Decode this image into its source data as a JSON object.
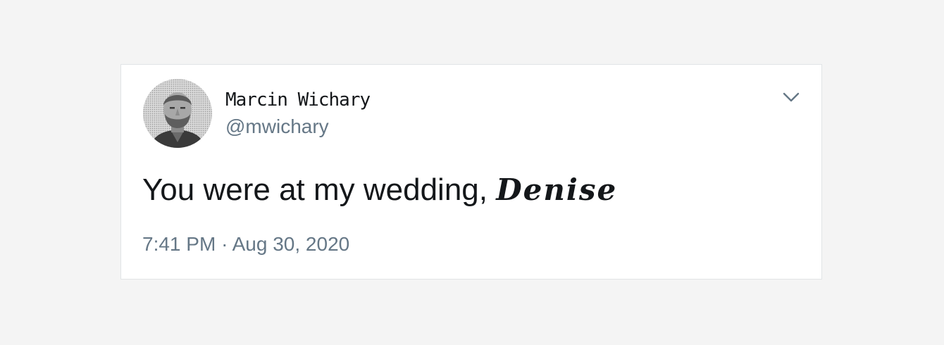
{
  "tweet": {
    "display_name": "Marcin Wichary",
    "handle": "@mwichary",
    "text_main": "You were at my wedding, ",
    "text_fancy": "Denise",
    "time": "7:41 PM",
    "separator": "·",
    "date": "Aug 30, 2020",
    "menu_icon": "chevron-down-icon",
    "avatar_icon": "avatar"
  },
  "colors": {
    "page_background": "#f4f4f4",
    "card_background": "#ffffff",
    "text_primary": "#14171a",
    "text_secondary": "#657786"
  }
}
